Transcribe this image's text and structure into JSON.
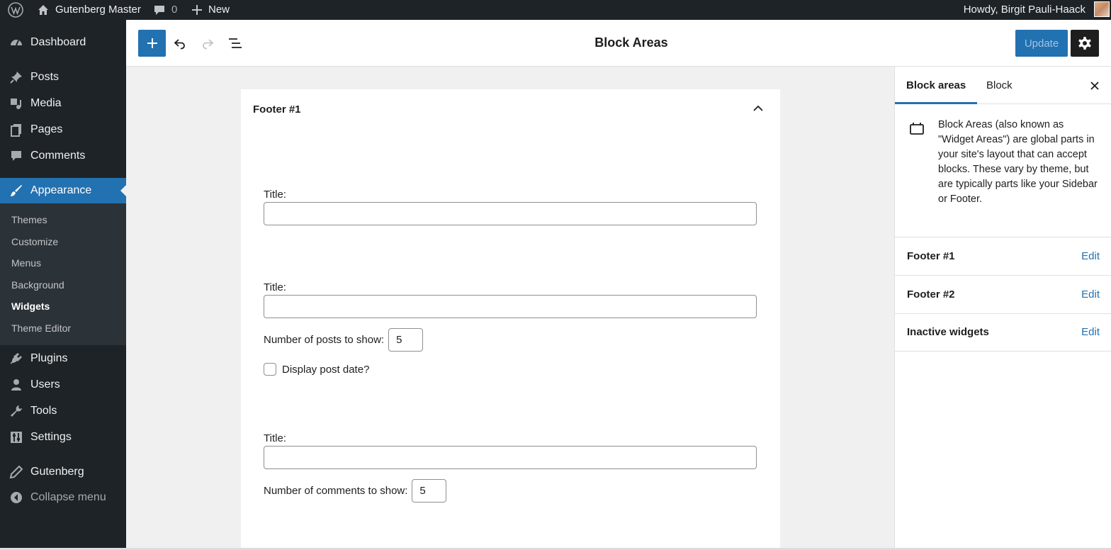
{
  "adminbar": {
    "site_name": "Gutenberg Master",
    "comments_count": "0",
    "new_label": "New",
    "howdy": "Howdy, Birgit Pauli-Haack"
  },
  "sidebar": {
    "items": [
      {
        "label": "Dashboard",
        "icon": "dashboard-icon"
      },
      {
        "label": "Posts",
        "icon": "pin-icon"
      },
      {
        "label": "Media",
        "icon": "media-icon"
      },
      {
        "label": "Pages",
        "icon": "pages-icon"
      },
      {
        "label": "Comments",
        "icon": "comment-icon"
      },
      {
        "label": "Appearance",
        "icon": "brush-icon"
      },
      {
        "label": "Plugins",
        "icon": "plug-icon"
      },
      {
        "label": "Users",
        "icon": "user-icon"
      },
      {
        "label": "Tools",
        "icon": "wrench-icon"
      },
      {
        "label": "Settings",
        "icon": "sliders-icon"
      },
      {
        "label": "Gutenberg",
        "icon": "pencil-icon"
      },
      {
        "label": "Collapse menu",
        "icon": "collapse-icon"
      }
    ],
    "submenu": [
      "Themes",
      "Customize",
      "Menus",
      "Background",
      "Widgets",
      "Theme Editor"
    ],
    "active_color": "#2271b1"
  },
  "header": {
    "title": "Block Areas",
    "update_label": "Update"
  },
  "canvas": {
    "area_title": "Footer #1",
    "title_label_1": "Title:",
    "title_label_2": "Title:",
    "posts_label": "Number of posts to show:",
    "posts_value": "5",
    "display_date_label": "Display post date?",
    "title_label_3": "Title:",
    "comments_label": "Number of comments to show:",
    "comments_value": "5"
  },
  "settings": {
    "tabs": [
      "Block areas",
      "Block"
    ],
    "description": "Block Areas (also known as \"Widget Areas\") are global parts in your site's layout that can accept blocks. These vary by theme, but are typically parts like your Sidebar or Footer.",
    "areas": [
      {
        "name": "Footer #1",
        "action": "Edit"
      },
      {
        "name": "Footer #2",
        "action": "Edit"
      },
      {
        "name": "Inactive widgets",
        "action": "Edit"
      }
    ]
  }
}
